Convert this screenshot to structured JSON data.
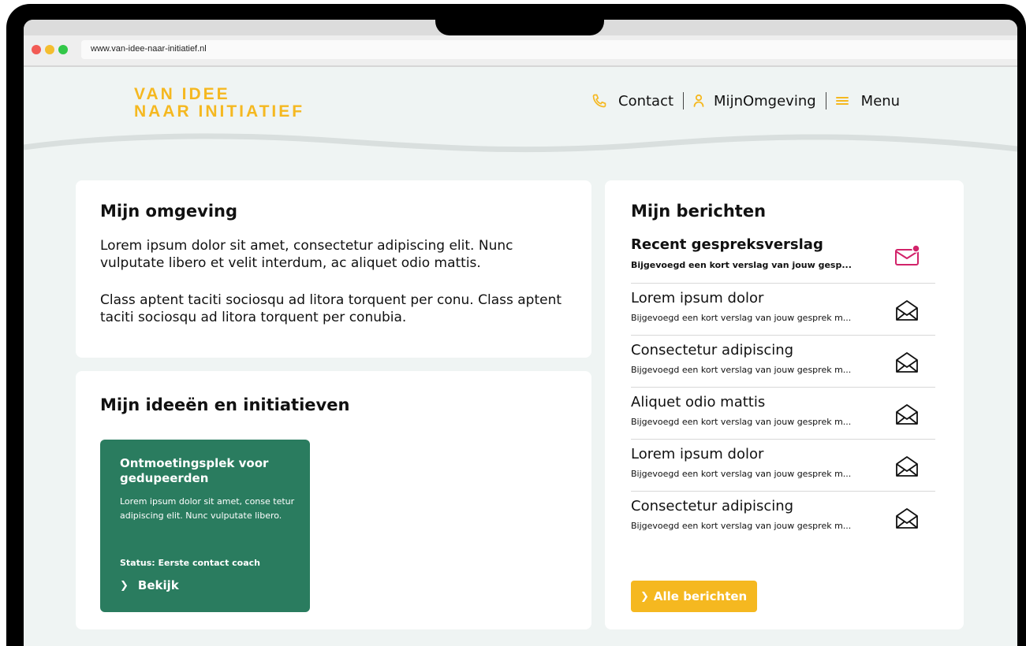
{
  "browser": {
    "url": "www.van-idee-naar-initiatief.nl"
  },
  "header": {
    "logo_line1": "VAN IDEE",
    "logo_line2": "NAAR INITIATIEF",
    "nav": [
      {
        "label": "Contact",
        "icon": "phone-icon"
      },
      {
        "label": "MijnOmgeving",
        "icon": "user-icon"
      },
      {
        "label": "Menu",
        "icon": "hamburger-icon"
      }
    ]
  },
  "omgeving": {
    "title": "Mijn omgeving",
    "paragraph1": "Lorem ipsum dolor sit amet, consectetur adipiscing elit. Nunc vulputate libero et velit interdum, ac aliquet odio mattis.",
    "paragraph2": "Class aptent taciti sociosqu ad litora torquent per conu. Class aptent taciti sociosqu ad litora torquent per conubia."
  },
  "ideeen": {
    "title": "Mijn ideeën en initiatieven",
    "card": {
      "title": "Ontmoetingsplek voor gedupeerden",
      "description": "Lorem ipsum dolor sit amet, conse tetur adipiscing elit. Nunc vulputate libero.",
      "status": "Status: Eerste contact coach",
      "link": "Bekijk"
    }
  },
  "berichten": {
    "title": "Mijn berichten",
    "items": [
      {
        "title": "Recent gespreksverslag",
        "subtitle": "Bijgevoegd een kort verslag van jouw gesp...",
        "unread": true
      },
      {
        "title": "Lorem ipsum dolor",
        "subtitle": "Bijgevoegd een kort verslag van jouw gesprek m...",
        "unread": false
      },
      {
        "title": "Consectetur adipiscing",
        "subtitle": "Bijgevoegd een kort verslag van jouw gesprek m...",
        "unread": false
      },
      {
        "title": "Aliquet odio mattis",
        "subtitle": "Bijgevoegd een kort verslag van jouw gesprek m...",
        "unread": false
      },
      {
        "title": "Lorem ipsum dolor",
        "subtitle": "Bijgevoegd een kort verslag van jouw gesprek m...",
        "unread": false
      },
      {
        "title": "Consectetur adipiscing",
        "subtitle": "Bijgevoegd een kort verslag van jouw gesprek m...",
        "unread": false
      }
    ],
    "button": "Alle berichten"
  },
  "colors": {
    "accent": "#f5b820",
    "green": "#2a7c5f",
    "unread": "#d2236a",
    "background": "#eff4f3"
  }
}
